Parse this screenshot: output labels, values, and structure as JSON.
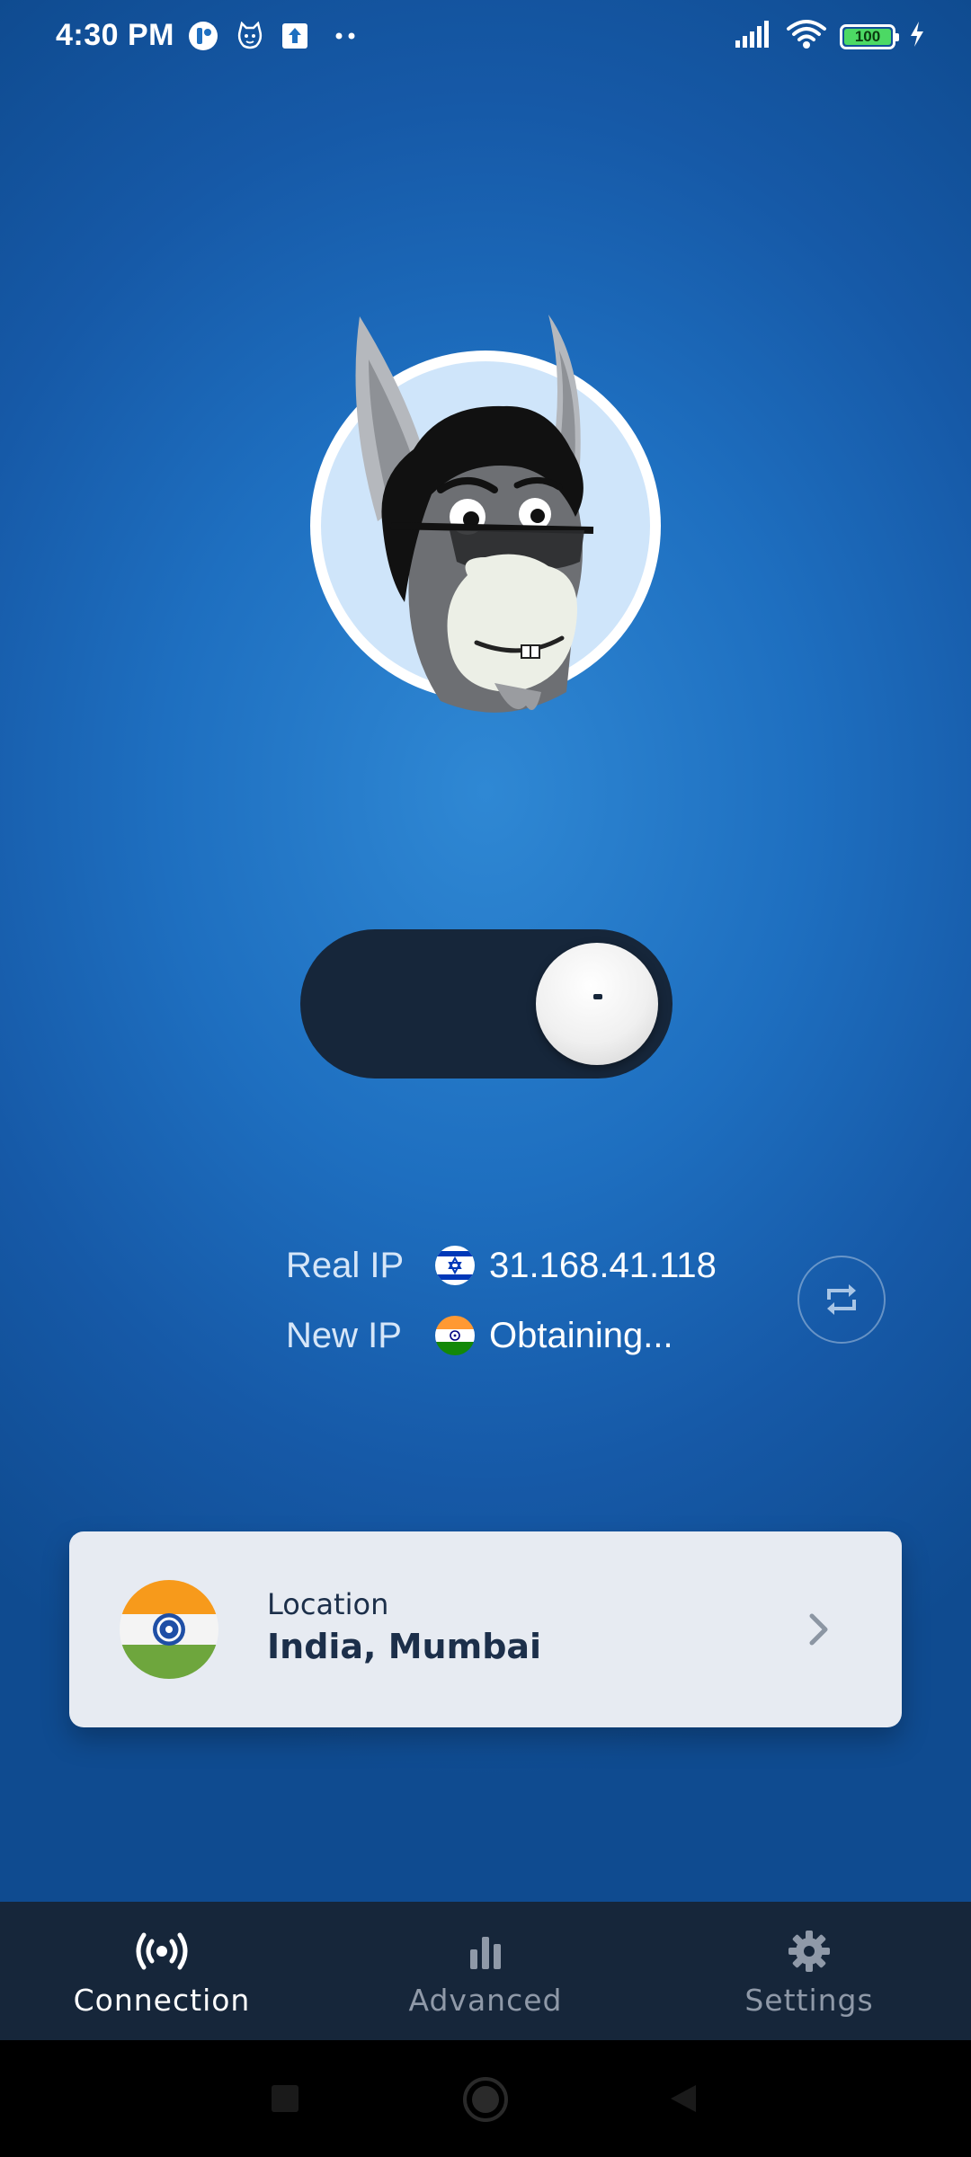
{
  "status_bar": {
    "time": "4:30 PM",
    "battery_level": "100",
    "icons": [
      "app-notification-icon",
      "cat-face-icon",
      "upload-icon",
      "more-dots-icon",
      "signal-icon",
      "wifi-icon",
      "battery-icon",
      "charging-icon"
    ]
  },
  "toggle": {
    "state": "on"
  },
  "ip_info": {
    "real_ip_label": "Real IP",
    "real_ip_value": "31.168.41.118",
    "real_ip_flag": "israel-flag-icon",
    "new_ip_label": "New IP",
    "new_ip_value": "Obtaining...",
    "new_ip_flag": "india-flag-icon"
  },
  "location_card": {
    "label": "Location",
    "value": "India, Mumbai",
    "flag": "india-flag-icon"
  },
  "bottom_nav": {
    "items": [
      {
        "label": "Connection",
        "icon": "broadcast-icon",
        "active": true
      },
      {
        "label": "Advanced",
        "icon": "bar-chart-icon",
        "active": false
      },
      {
        "label": "Settings",
        "icon": "gear-icon",
        "active": false
      }
    ]
  },
  "colors": {
    "background": "#1e6fc0",
    "toggle_track": "#16263a",
    "card_background": "#e7ebf2",
    "nav_background": "#16263a",
    "accent_text": "#1c2f4a"
  }
}
